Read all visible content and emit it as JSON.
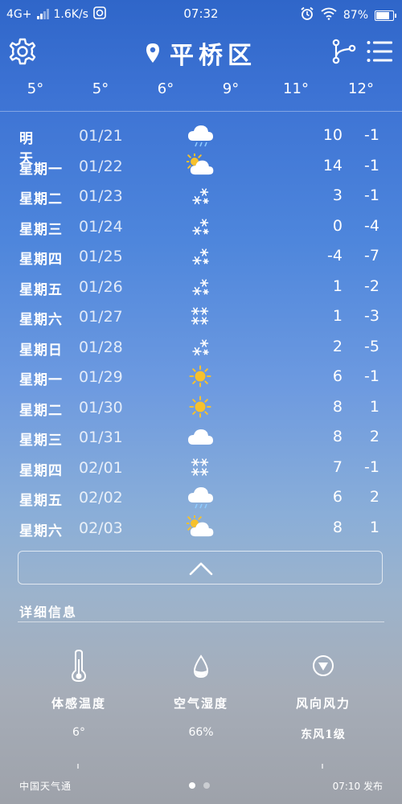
{
  "status_bar": {
    "network": "4G+",
    "speed": "1.6K/s",
    "time": "07:32",
    "battery": "87%"
  },
  "header": {
    "city": "平桥区"
  },
  "hourly_temps": [
    "5°",
    "5°",
    "6°",
    "9°",
    "11°",
    "12°"
  ],
  "forecast": [
    {
      "day": "明 天",
      "date": "01/21",
      "icon": "cloud-rain-icon",
      "high": "10",
      "low": "-1"
    },
    {
      "day": "星期一",
      "date": "01/22",
      "icon": "sun-cloud-icon",
      "high": "14",
      "low": "-1"
    },
    {
      "day": "星期二",
      "date": "01/23",
      "icon": "snow-icon",
      "high": "3",
      "low": "-1"
    },
    {
      "day": "星期三",
      "date": "01/24",
      "icon": "snow-icon",
      "high": "0",
      "low": "-4"
    },
    {
      "day": "星期四",
      "date": "01/25",
      "icon": "snow-icon",
      "high": "-4",
      "low": "-7"
    },
    {
      "day": "星期五",
      "date": "01/26",
      "icon": "snow-icon",
      "high": "1",
      "low": "-2"
    },
    {
      "day": "星期六",
      "date": "01/27",
      "icon": "heavy-snow-icon",
      "high": "1",
      "low": "-3"
    },
    {
      "day": "星期日",
      "date": "01/28",
      "icon": "snow-icon",
      "high": "2",
      "low": "-5"
    },
    {
      "day": "星期一",
      "date": "01/29",
      "icon": "sun-icon",
      "high": "6",
      "low": "-1"
    },
    {
      "day": "星期二",
      "date": "01/30",
      "icon": "sun-icon",
      "high": "8",
      "low": "1"
    },
    {
      "day": "星期三",
      "date": "01/31",
      "icon": "cloud-icon",
      "high": "8",
      "low": "2"
    },
    {
      "day": "星期四",
      "date": "02/01",
      "icon": "heavy-snow-icon",
      "high": "7",
      "low": "-1"
    },
    {
      "day": "星期五",
      "date": "02/02",
      "icon": "cloud-rain-icon",
      "high": "6",
      "low": "2"
    },
    {
      "day": "星期六",
      "date": "02/03",
      "icon": "sun-cloud-icon",
      "high": "8",
      "low": "1"
    }
  ],
  "details": {
    "title": "详细信息",
    "items": [
      {
        "label": "体感温度",
        "value": "6°",
        "icon": "thermometer-icon"
      },
      {
        "label": "空气湿度",
        "value": "66%",
        "icon": "water-drop-icon"
      },
      {
        "label": "风向风力",
        "value": "东风1级",
        "icon": "wind-direction-icon"
      }
    ]
  },
  "footer": {
    "source": "中国天气通",
    "published": "07:10 发布",
    "pages": 2,
    "active_page": 1
  }
}
